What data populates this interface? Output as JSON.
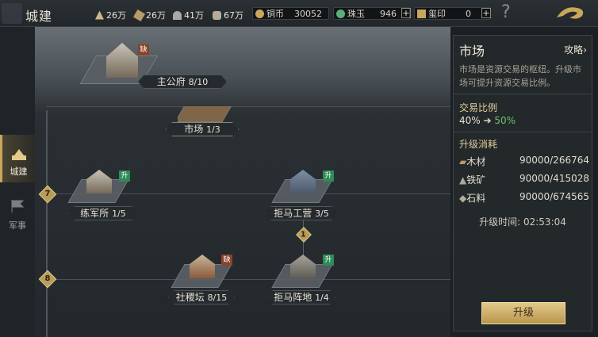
{
  "header": {
    "title": "城建",
    "resources": [
      {
        "icon": "grain-icon",
        "value": "26万"
      },
      {
        "icon": "wood-icon",
        "value": "26万"
      },
      {
        "icon": "iron-icon",
        "value": "41万"
      },
      {
        "icon": "stone-icon",
        "value": "67万"
      }
    ],
    "currencies": [
      {
        "icon": "copper-coin-icon",
        "label": "铜币",
        "value": "30052"
      },
      {
        "icon": "jade-icon",
        "label": "珠玉",
        "value": "946"
      },
      {
        "icon": "seal-icon",
        "label": "玺印",
        "value": "0"
      }
    ],
    "help": "?"
  },
  "sidebar": {
    "items": [
      {
        "label": "城建",
        "icon": "city-icon",
        "active": true
      },
      {
        "label": "军事",
        "icon": "flag-icon",
        "active": false
      }
    ]
  },
  "tree": {
    "main_hall": {
      "name": "主公府",
      "level": "8/10",
      "badge": "缺"
    },
    "market": {
      "name": "市场",
      "level": "1/3"
    },
    "rows": [
      {
        "level": "7"
      },
      {
        "level": "8"
      }
    ],
    "training": {
      "name": "练军所",
      "level": "1/5",
      "badge": "升"
    },
    "barracks": {
      "name": "拒马工营",
      "level": "3/5",
      "badge": "升"
    },
    "connector": "1",
    "altar": {
      "name": "社稷坛",
      "level": "8/15",
      "badge": "缺"
    },
    "barricade": {
      "name": "拒马阵地",
      "level": "1/4",
      "badge": "升"
    }
  },
  "panel": {
    "title": "市场",
    "guide": "攻略",
    "desc": "市场是资源交易的枢纽。升级市场可提升资源交易比例。",
    "ratio_title": "交易比例",
    "ratio_from": "40%",
    "arrow": "➔",
    "ratio_to": "50%",
    "cost_title": "升级消耗",
    "costs": [
      {
        "icon": "wood-icon",
        "label": "木材",
        "value": "90000/266764"
      },
      {
        "icon": "iron-icon",
        "label": "铁矿",
        "value": "90000/415028"
      },
      {
        "icon": "stone-icon",
        "label": "石料",
        "value": "90000/674565"
      }
    ],
    "time_label": "升级时间:",
    "time": "02:53:04",
    "button": "升级"
  }
}
